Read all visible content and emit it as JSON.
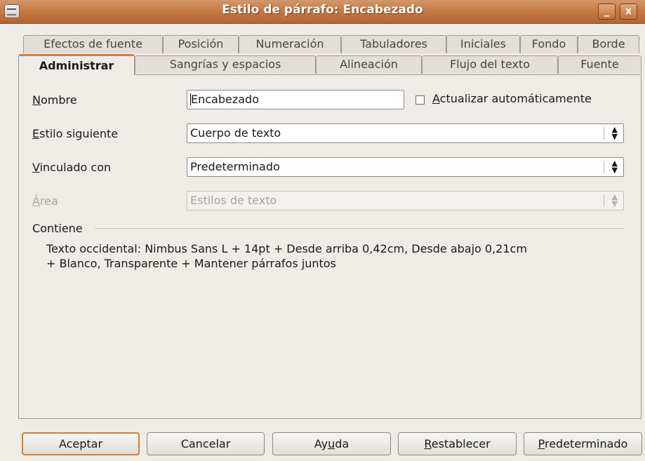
{
  "window": {
    "title": "Estilo de párrafo: Encabezado",
    "minimize_glyph": "_",
    "close_glyph": "x"
  },
  "tabs_back": [
    "Efectos de fuente",
    "Posición",
    "Numeración",
    "Tabuladores",
    "Iniciales",
    "Fondo",
    "Borde"
  ],
  "tabs_front": [
    "Administrar",
    "Sangrías y espacios",
    "Alineación",
    "Flujo del texto",
    "Fuente"
  ],
  "active_tab": "Administrar",
  "form": {
    "name_label": {
      "mnemonic": "N",
      "rest": "ombre"
    },
    "name_value": "Encabezado",
    "auto_update_label": {
      "mnemonic": "A",
      "rest": "ctualizar automáticamente"
    },
    "auto_update_checked": false,
    "next_style_label": {
      "mnemonic": "E",
      "rest": "stilo siguiente"
    },
    "next_style_value": "Cuerpo de texto",
    "linked_label": {
      "mnemonic": "V",
      "rest": "inculado con"
    },
    "linked_value": "Predeterminado",
    "area_label": {
      "mnemonic": "Á",
      "rest": "rea"
    },
    "area_value": "Estilos de texto"
  },
  "contains": {
    "title": "Contiene",
    "line1": "Texto occidental: Nimbus Sans L + 14pt + Desde arriba 0,42cm, Desde abajo 0,21cm",
    "line2": "+ Blanco, Transparente + Mantener párrafos juntos"
  },
  "buttons": {
    "ok": "Aceptar",
    "cancel": "Cancelar",
    "help": {
      "pre": "Ay",
      "mnemonic": "u",
      "post": "da"
    },
    "reset": {
      "mnemonic": "R",
      "rest": "establecer"
    },
    "default": {
      "mnemonic": "P",
      "rest": "redeterminado"
    }
  },
  "colors": {
    "titlebar": "#c67a46",
    "tab_accent": "#d57e3c",
    "window_bg": "#efebe7"
  },
  "icons": {
    "app": "document-style-icon",
    "combo_arrow": "up-down-arrows-icon"
  }
}
